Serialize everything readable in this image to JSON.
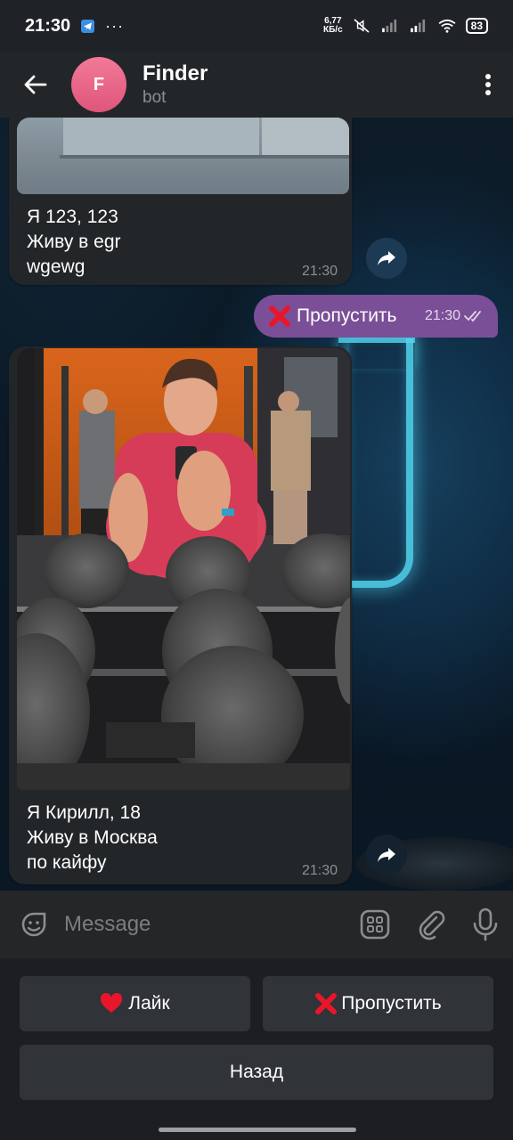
{
  "status_bar": {
    "time": "21:30",
    "dots": "···",
    "net_speed_top": "6,77",
    "net_speed_bottom": "КБ/с",
    "battery": "83"
  },
  "header": {
    "avatar_letter": "F",
    "title": "Finder",
    "subtitle": "bot"
  },
  "messages": {
    "first": {
      "lines": [
        "Я 123, 123",
        "Живу в egr",
        "wgewg"
      ],
      "time": "21:30"
    },
    "outgoing": {
      "text": "Пропустить",
      "time": "21:30"
    },
    "second": {
      "lines": [
        "Я Кирилл, 18",
        "Живу в Москва",
        "по кайфу"
      ],
      "time": "21:30"
    }
  },
  "input": {
    "placeholder": "Message"
  },
  "keyboard": {
    "like_label": "Лайк",
    "skip_label": "Пропустить",
    "back_label": "Назад"
  },
  "colors": {
    "accent_outgoing": "#7a4f97",
    "avatar": "#e0557b"
  }
}
